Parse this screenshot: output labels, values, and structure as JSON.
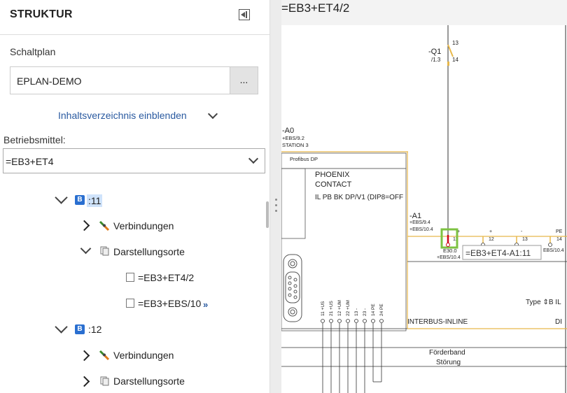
{
  "panel": {
    "title": "STRUKTUR",
    "schaltplan_label": "Schaltplan",
    "schaltplan_value": "EPLAN-DEMO",
    "browse_label": "...",
    "toc_link": "Inhaltsverzeichnis einblenden",
    "betriebsmittel_label": "Betriebsmittel:",
    "betriebsmittel_value": "=EB3+ET4"
  },
  "tree": {
    "node1": {
      "badge": "B",
      "label": ":11",
      "verbindungen": "Verbindungen",
      "darstellungsorte": "Darstellungsorte",
      "places": [
        "=EB3+ET4/2",
        "=EB3+EBS/10"
      ],
      "more_marker": "»"
    },
    "node2": {
      "badge": "B",
      "label": ":12",
      "verbindungen": "Verbindungen",
      "darstellungsorte": "Darstellungsorte"
    }
  },
  "view": {
    "title": "=EB3+ET4/2"
  },
  "schematic": {
    "q1_label": "-Q1",
    "q1_ref": "/1.3",
    "q1_pin_top": "13",
    "q1_pin_bottom": "14",
    "a0_label": "-A0",
    "a0_line1": "+EBS/9.2",
    "a0_line2": "STATION 3",
    "profibus_header": "Profibus DP",
    "module_line1": "PHOENIX",
    "module_line2": "CONTACT",
    "module_line3": "IL PB BK DP/V1 (DIP8=OFF",
    "a1_label": "-A1",
    "a1_line1": "+EBS/9.4",
    "a1_line2": "+EBS/10.4",
    "pin_labels": [
      "11",
      "12",
      "13",
      "14"
    ],
    "e30_label": "E30.0",
    "e30_ref": "+EBS/10.4",
    "ebs_ref_right": "EBS/10.4",
    "tooltip": "=EB3+ET4-A1:11",
    "type_label": "Type ⇕B IL",
    "interbus_label": "INTERBUS-INLINE",
    "di_label": "DI",
    "vert_terminals": [
      "11 +US",
      "21 +US",
      "12 +UM",
      "22 +UM",
      "13 -",
      "23 -",
      "14 PE",
      "24 PE"
    ],
    "foerderband": "Förderband",
    "stoerung": "Störung"
  },
  "colors": {
    "accent_link": "#2a5aa0",
    "wire_yellow": "#e8b84a",
    "highlight_green": "#7dc242",
    "selection_blue": "#cfe3fb",
    "contact_red": "#d0021b"
  }
}
